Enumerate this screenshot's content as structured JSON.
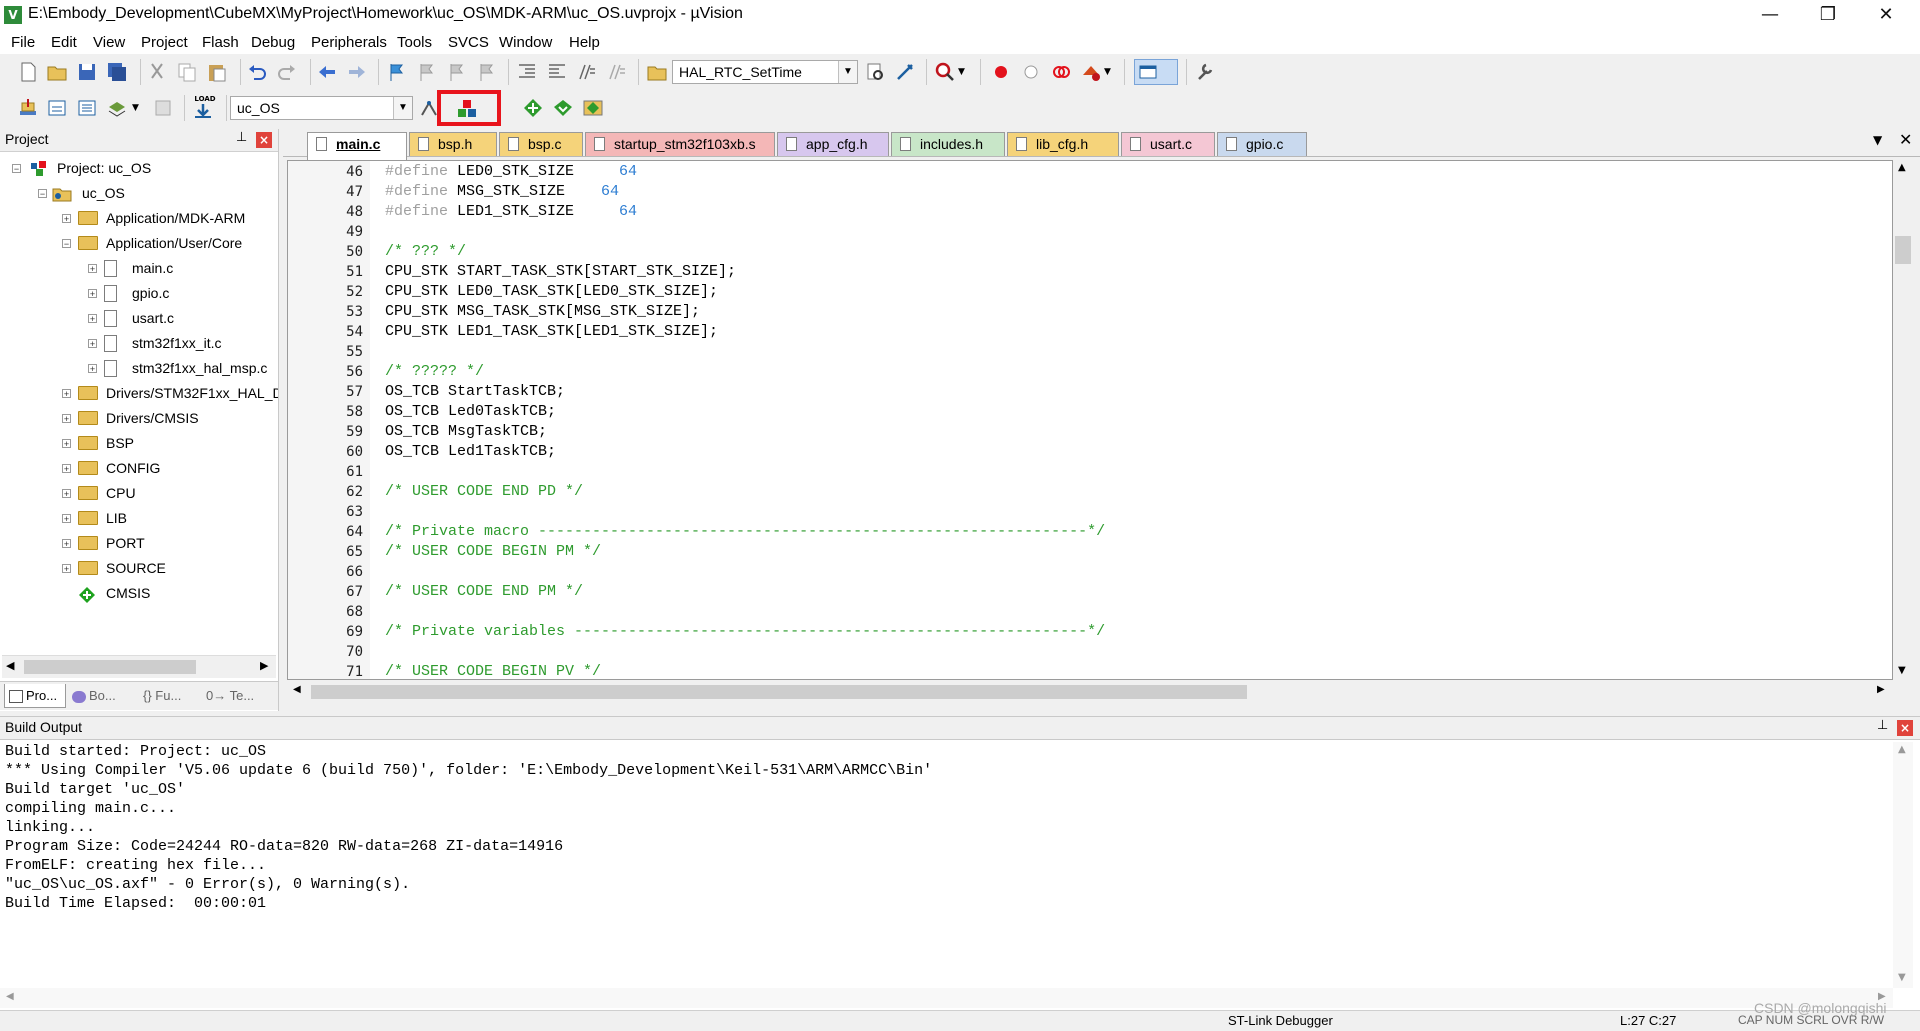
{
  "window": {
    "title": "E:\\Embody_Development\\CubeMX\\MyProject\\Homework\\uc_OS\\MDK-ARM\\uc_OS.uvprojx - µVision",
    "minimize_glyph": "—",
    "restore_glyph": "❐",
    "close_glyph": "✕"
  },
  "menu": [
    "File",
    "Edit",
    "View",
    "Project",
    "Flash",
    "Debug",
    "Peripherals",
    "Tools",
    "SVCS",
    "Window",
    "Help"
  ],
  "toolbar": {
    "function_combo": "HAL_RTC_SetTime",
    "target_combo": "uc_OS",
    "load_label": "LOAD"
  },
  "project": {
    "panel_title": "Project",
    "root": "Project: uc_OS",
    "target": "uc_OS",
    "groups": [
      {
        "label": "Application/MDK-ARM",
        "expander": "+"
      },
      {
        "label": "Application/User/Core",
        "expander": "−"
      },
      {
        "label": "main.c",
        "expander": "+"
      },
      {
        "label": "gpio.c",
        "expander": "+"
      },
      {
        "label": "usart.c",
        "expander": "+"
      },
      {
        "label": "stm32f1xx_it.c",
        "expander": "+"
      },
      {
        "label": "stm32f1xx_hal_msp.c",
        "expander": "+"
      },
      {
        "label": "Drivers/STM32F1xx_HAL_D",
        "expander": "+"
      },
      {
        "label": "Drivers/CMSIS",
        "expander": "+"
      },
      {
        "label": "BSP",
        "expander": "+"
      },
      {
        "label": "CONFIG",
        "expander": "+"
      },
      {
        "label": "CPU",
        "expander": "+"
      },
      {
        "label": "LIB",
        "expander": "+"
      },
      {
        "label": "PORT",
        "expander": "+"
      },
      {
        "label": "SOURCE",
        "expander": "+"
      },
      {
        "label": "CMSIS",
        "expander": ""
      }
    ],
    "bottom_tabs": [
      "Pro...",
      "Bo...",
      "{} Fu...",
      "0→ Te..."
    ]
  },
  "editor": {
    "tabs": [
      {
        "label": "main.c",
        "color": "#ffffff",
        "active": true
      },
      {
        "label": "bsp.h",
        "color": "#f5d37a"
      },
      {
        "label": "bsp.c",
        "color": "#f5d37a"
      },
      {
        "label": "startup_stm32f103xb.s",
        "color": "#f4b7b7"
      },
      {
        "label": "app_cfg.h",
        "color": "#d7c7ee"
      },
      {
        "label": "includes.h",
        "color": "#c8e6c8"
      },
      {
        "label": "lib_cfg.h",
        "color": "#f5d37a"
      },
      {
        "label": "usart.c",
        "color": "#f4c7d4"
      },
      {
        "label": "gpio.c",
        "color": "#c9d9ee"
      }
    ],
    "lines": [
      {
        "n": "46",
        "parts": [
          [
            "pp",
            "#define"
          ],
          [
            "",
            " LED0_STK_SIZE     "
          ],
          [
            "num",
            "64"
          ]
        ]
      },
      {
        "n": "47",
        "parts": [
          [
            "pp",
            "#define"
          ],
          [
            "",
            " MSG_STK_SIZE    "
          ],
          [
            "num",
            "64"
          ]
        ]
      },
      {
        "n": "48",
        "parts": [
          [
            "pp",
            "#define"
          ],
          [
            "",
            " LED1_STK_SIZE     "
          ],
          [
            "num",
            "64"
          ]
        ]
      },
      {
        "n": "49",
        "parts": []
      },
      {
        "n": "50",
        "parts": [
          [
            "com",
            "/* ??? */"
          ]
        ]
      },
      {
        "n": "51",
        "parts": [
          [
            "",
            "CPU_STK START_TASK_STK[START_STK_SIZE];"
          ]
        ]
      },
      {
        "n": "52",
        "parts": [
          [
            "",
            "CPU_STK LED0_TASK_STK[LED0_STK_SIZE];"
          ]
        ]
      },
      {
        "n": "53",
        "parts": [
          [
            "",
            "CPU_STK MSG_TASK_STK[MSG_STK_SIZE];"
          ]
        ]
      },
      {
        "n": "54",
        "parts": [
          [
            "",
            "CPU_STK LED1_TASK_STK[LED1_STK_SIZE];"
          ]
        ]
      },
      {
        "n": "55",
        "parts": []
      },
      {
        "n": "56",
        "parts": [
          [
            "com",
            "/* ????? */"
          ]
        ]
      },
      {
        "n": "57",
        "parts": [
          [
            "",
            "OS_TCB StartTaskTCB;"
          ]
        ]
      },
      {
        "n": "58",
        "parts": [
          [
            "",
            "OS_TCB Led0TaskTCB;"
          ]
        ]
      },
      {
        "n": "59",
        "parts": [
          [
            "",
            "OS_TCB MsgTaskTCB;"
          ]
        ]
      },
      {
        "n": "60",
        "parts": [
          [
            "",
            "OS_TCB Led1TaskTCB;"
          ]
        ]
      },
      {
        "n": "61",
        "parts": []
      },
      {
        "n": "62",
        "parts": [
          [
            "com",
            "/* USER CODE END PD */"
          ]
        ]
      },
      {
        "n": "63",
        "parts": []
      },
      {
        "n": "64",
        "parts": [
          [
            "com",
            "/* Private macro -------------------------------------------------------------*/"
          ]
        ]
      },
      {
        "n": "65",
        "parts": [
          [
            "com",
            "/* USER CODE BEGIN PM */"
          ]
        ]
      },
      {
        "n": "66",
        "parts": []
      },
      {
        "n": "67",
        "parts": [
          [
            "com",
            "/* USER CODE END PM */"
          ]
        ]
      },
      {
        "n": "68",
        "parts": []
      },
      {
        "n": "69",
        "parts": [
          [
            "com",
            "/* Private variables ---------------------------------------------------------*/"
          ]
        ]
      },
      {
        "n": "70",
        "parts": []
      },
      {
        "n": "71",
        "parts": [
          [
            "com",
            "/* USER CODE BEGIN PV */"
          ]
        ]
      }
    ]
  },
  "build": {
    "title": "Build Output",
    "lines": [
      "Build started: Project: uc_OS",
      "*** Using Compiler 'V5.06 update 6 (build 750)', folder: 'E:\\Embody_Development\\Keil-531\\ARM\\ARMCC\\Bin'",
      "Build target 'uc_OS'",
      "compiling main.c...",
      "linking...",
      "Program Size: Code=24244 RO-data=820 RW-data=268 ZI-data=14916",
      "FromELF: creating hex file...",
      "\"uc_OS\\uc_OS.axf\" - 0 Error(s), 0 Warning(s).",
      "Build Time Elapsed:  00:00:01"
    ]
  },
  "status": {
    "debugger": "ST-Link Debugger",
    "position": "L:27 C:27",
    "indicators": "CAP  NUM  SCRL  OVR  R/W",
    "watermark": "CSDN @molongqishi"
  },
  "colors": {
    "highlight_box": "#e8141c",
    "comment": "#2e9b2e",
    "number": "#2d7dd2"
  }
}
